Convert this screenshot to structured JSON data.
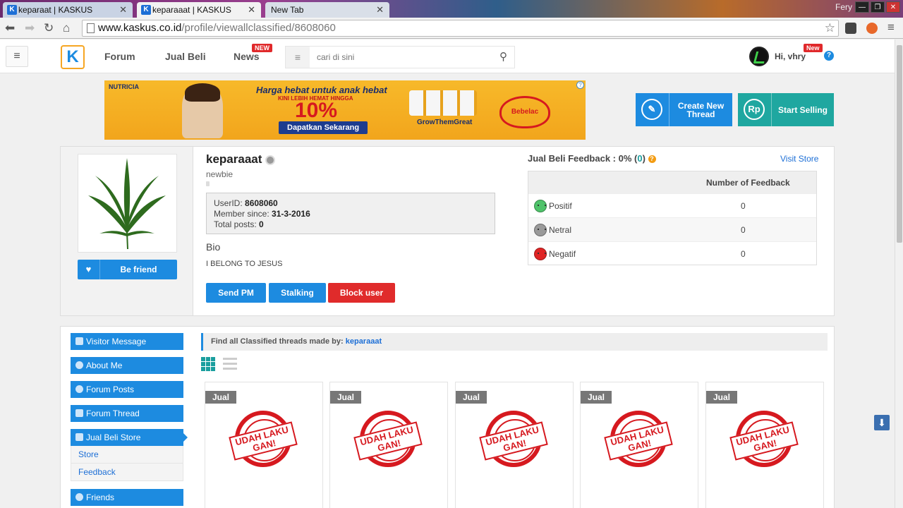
{
  "browser": {
    "tabs": [
      {
        "title": "keparaat | KASKUS",
        "active": false
      },
      {
        "title": "keparaaat | KASKUS",
        "active": true
      },
      {
        "title": "New Tab",
        "active": false
      }
    ],
    "user_chip": "Fery",
    "url_domain": "www.kaskus.co.id",
    "url_path": "/profile/viewallclassified/8608060"
  },
  "header": {
    "nav": [
      "Forum",
      "Jual Beli",
      "News"
    ],
    "news_badge": "NEW",
    "search_placeholder": "cari di sini",
    "greeting": "Hi, vhry",
    "user_badge": "New"
  },
  "ad": {
    "brand": "NUTRICIA",
    "headline": "Harga hebat untuk anak hebat",
    "subline": "KINI LEBIH HEMAT HINGGA",
    "percent": "10%",
    "cta": "Dapatkan Sekarang",
    "tagline": "GrowThemGreat",
    "logo": "Bebelac"
  },
  "actions": {
    "create_thread": "Create New Thread",
    "start_selling": "Start Selling"
  },
  "profile": {
    "username": "keparaaat",
    "rank": "newbie",
    "userid_label": "UserID:",
    "userid": "8608060",
    "member_since_label": "Member since:",
    "member_since": "31-3-2016",
    "total_posts_label": "Total posts:",
    "total_posts": "0",
    "bio_label": "Bio",
    "bio": "I BELONG TO JESUS",
    "be_friend": "Be friend",
    "send_pm": "Send PM",
    "stalking": "Stalking",
    "block_user": "Block user"
  },
  "feedback": {
    "title_prefix": "Jual Beli Feedback : 0% (",
    "count": "0",
    "title_suffix": ")",
    "visit_store": "Visit Store",
    "column_header": "Number of Feedback",
    "rows": [
      {
        "label": "Positif",
        "value": "0",
        "color": "#4fc36a"
      },
      {
        "label": "Netral",
        "value": "0",
        "color": "#9a9a9a"
      },
      {
        "label": "Negatif",
        "value": "0",
        "color": "#e02424"
      }
    ]
  },
  "sidebar": {
    "items": [
      {
        "label": "Visitor Message"
      },
      {
        "label": "About Me"
      },
      {
        "label": "Forum Posts"
      },
      {
        "label": "Forum Thread"
      },
      {
        "label": "Jual Beli Store"
      },
      {
        "label": "Friends"
      }
    ],
    "sub_items": [
      "Store",
      "Feedback"
    ]
  },
  "classifieds": {
    "find_label": "Find all Classified threads made by:",
    "find_user": "keparaaat",
    "cards": [
      {
        "tag": "Jual",
        "stamp": "UDAH LAKU GAN!"
      },
      {
        "tag": "Jual",
        "stamp": "UDAH LAKU GAN!"
      },
      {
        "tag": "Jual",
        "stamp": "UDAH LAKU GAN!"
      },
      {
        "tag": "Jual",
        "stamp": "UDAH LAKU GAN!"
      },
      {
        "tag": "Jual",
        "stamp": "UDAH LAKU GAN!"
      }
    ]
  },
  "colors": {
    "kaskus_blue": "#1d8be0",
    "teal": "#1fa7a0",
    "red": "#e02b2b"
  }
}
